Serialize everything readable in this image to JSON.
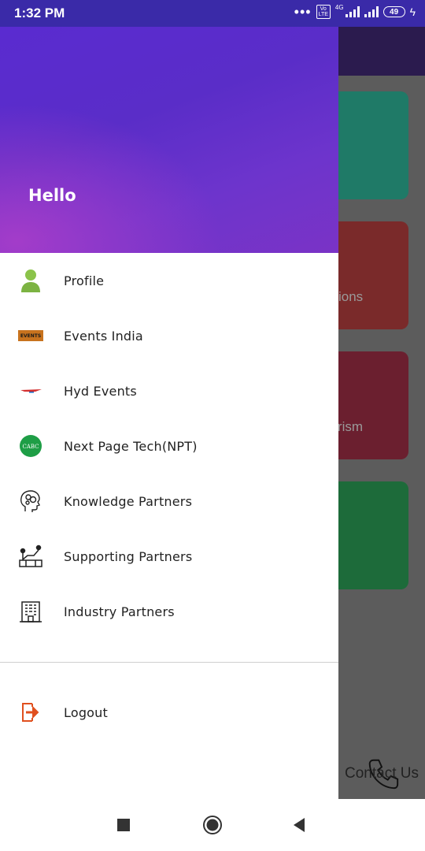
{
  "status_bar": {
    "time": "1:32 PM",
    "network": "4G",
    "volte": "Vo LTE",
    "battery": "49"
  },
  "background_screen": {
    "card_labels": [
      "ions",
      "ourism"
    ],
    "card_colors": [
      "#1f7a67",
      "#7a2a2a",
      "#6b1f2f",
      "#1d6b3a"
    ],
    "contact_label": "Contact Us",
    "contact_icon": "phone-icon"
  },
  "drawer": {
    "greeting": "Hello",
    "items": [
      {
        "label": "Profile",
        "icon": "profile-icon"
      },
      {
        "label": "Events India",
        "icon": "events-india-logo"
      },
      {
        "label": "Hyd Events",
        "icon": "hyd-events-logo"
      },
      {
        "label": "Next Page Tech(NPT)",
        "icon": "cabc-logo",
        "icon_text": "CABC"
      },
      {
        "label": "Knowledge Partners",
        "icon": "brain-head-icon"
      },
      {
        "label": "Supporting Partners",
        "icon": "handshake-icon"
      },
      {
        "label": "Industry Partners",
        "icon": "building-icon"
      }
    ],
    "logout": {
      "label": "Logout",
      "icon": "logout-icon"
    },
    "events_logo_text": "EVENTS",
    "header_color": "#5a2bd0",
    "logout_color": "#e0501f"
  },
  "nav_bar": {
    "buttons": [
      "recents-button",
      "home-button",
      "back-button"
    ]
  }
}
